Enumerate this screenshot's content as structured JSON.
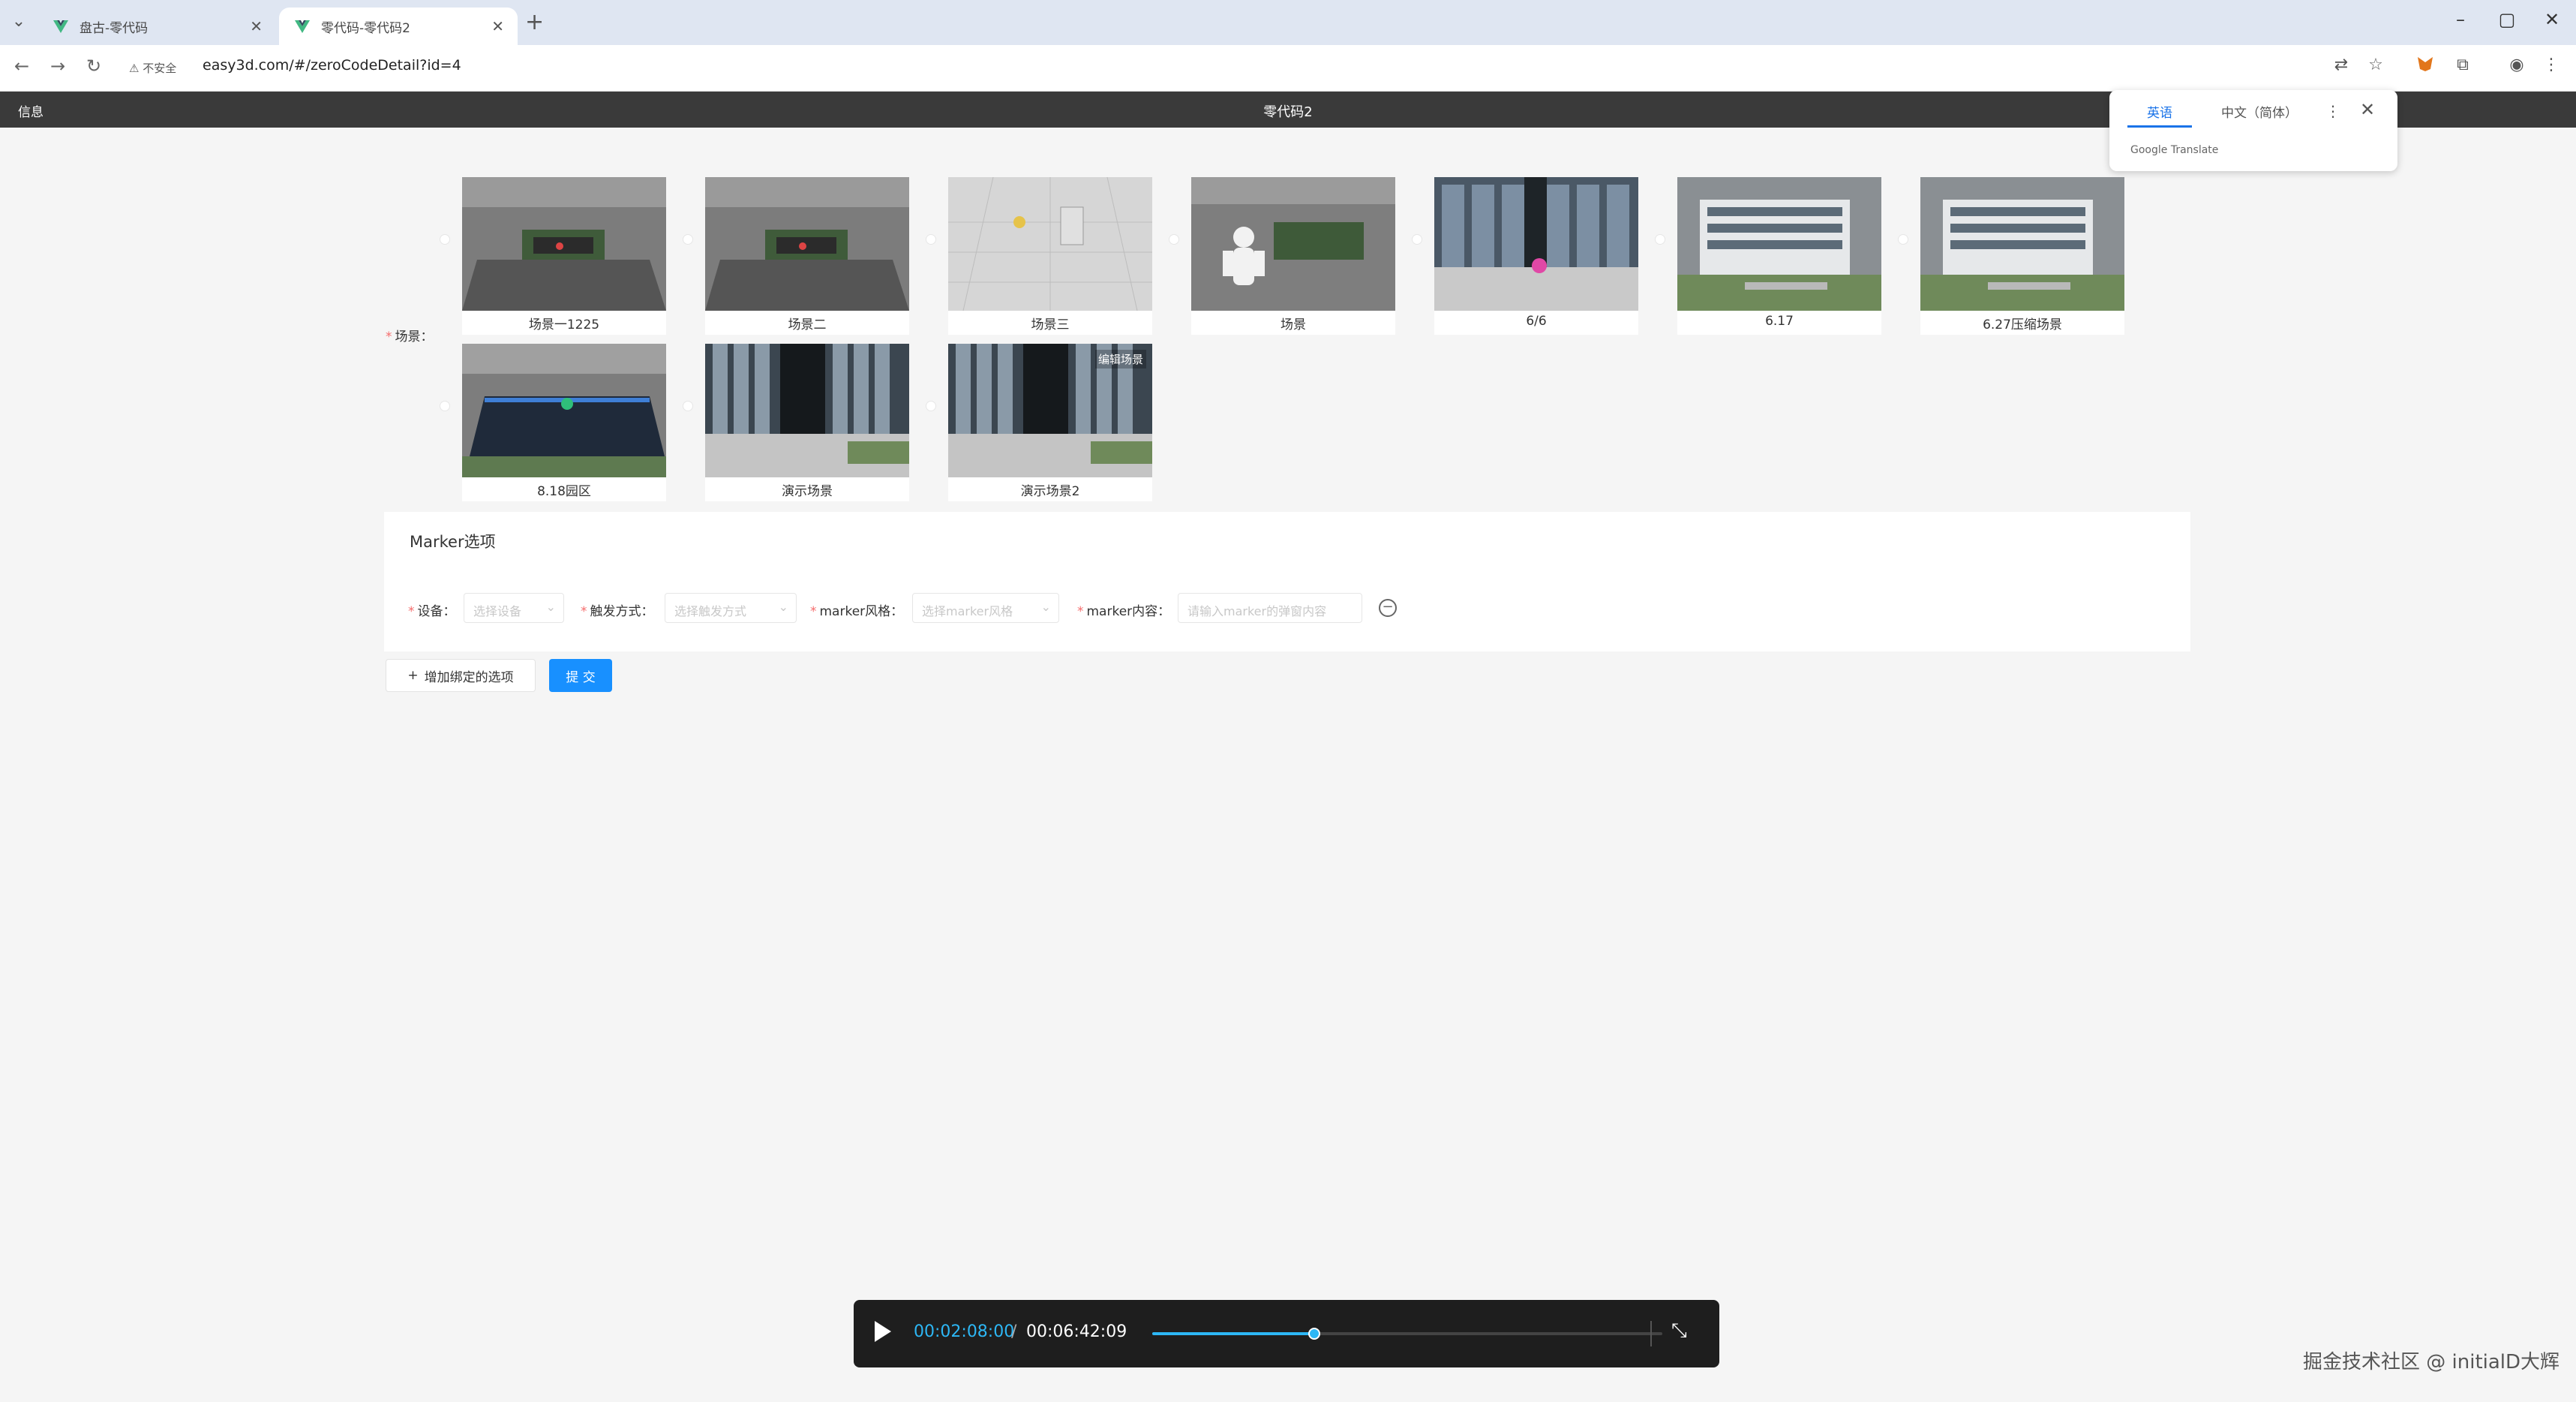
{
  "browser": {
    "tabs": [
      {
        "title": "盘古-零代码"
      },
      {
        "title": "零代码-零代码2"
      }
    ],
    "security_label": "不安全",
    "url": "easy3d.com/#/zeroCodeDetail?id=4",
    "icons": {
      "tab_menu": "chevron-down-icon",
      "new_tab": "plus-icon",
      "back": "arrow-left-icon",
      "forward": "arrow-right-icon",
      "reload": "reload-icon",
      "translate": "translate-icon",
      "bookmark": "star-icon",
      "extension": "puzzle-icon",
      "profile": "profile-icon",
      "menu": "kebab-menu-icon"
    }
  },
  "appbar": {
    "left_label": "信息",
    "title": "零代码2"
  },
  "translate_popup": {
    "tab_active": "英语",
    "tab_other": "中文（简体）",
    "brand": "Google Translate"
  },
  "scenes": {
    "label": "场景：",
    "items": [
      {
        "name": "场景一1225",
        "theme": "plaza"
      },
      {
        "name": "场景二",
        "theme": "plaza"
      },
      {
        "name": "场景三",
        "theme": "grid"
      },
      {
        "name": "场景",
        "theme": "robot"
      },
      {
        "name": "6/6",
        "theme": "building"
      },
      {
        "name": "6.17",
        "theme": "building2"
      },
      {
        "name": "6.27压缩场景",
        "theme": "building2"
      },
      {
        "name": "8.18园区",
        "theme": "park"
      },
      {
        "name": "演示场景",
        "theme": "tower"
      },
      {
        "name": "演示场景2",
        "theme": "tower",
        "tag": "编辑场景"
      }
    ]
  },
  "marker": {
    "title": "Marker选项",
    "fields": [
      {
        "label": "设备：",
        "placeholder": "选择设备"
      },
      {
        "label": "触发方式：",
        "placeholder": "选择触发方式"
      },
      {
        "label": "marker风格：",
        "placeholder": "选择marker风格"
      },
      {
        "label": "marker内容：",
        "placeholder": "请输入marker的弹窗内容"
      }
    ]
  },
  "actions": {
    "add_label": "增加绑定的选项",
    "submit_label": "提 交"
  },
  "player": {
    "current_time": "00:02:08:00",
    "separator": "/",
    "total_time": "00:06:42:09",
    "progress": 0.318
  },
  "watermark": "掘金技术社区 @ initialD大辉",
  "colors": {
    "accent": "#1890ff",
    "player_accent": "#2db7f5",
    "required": "#f56c6c",
    "appbar": "#3a3a3a"
  }
}
